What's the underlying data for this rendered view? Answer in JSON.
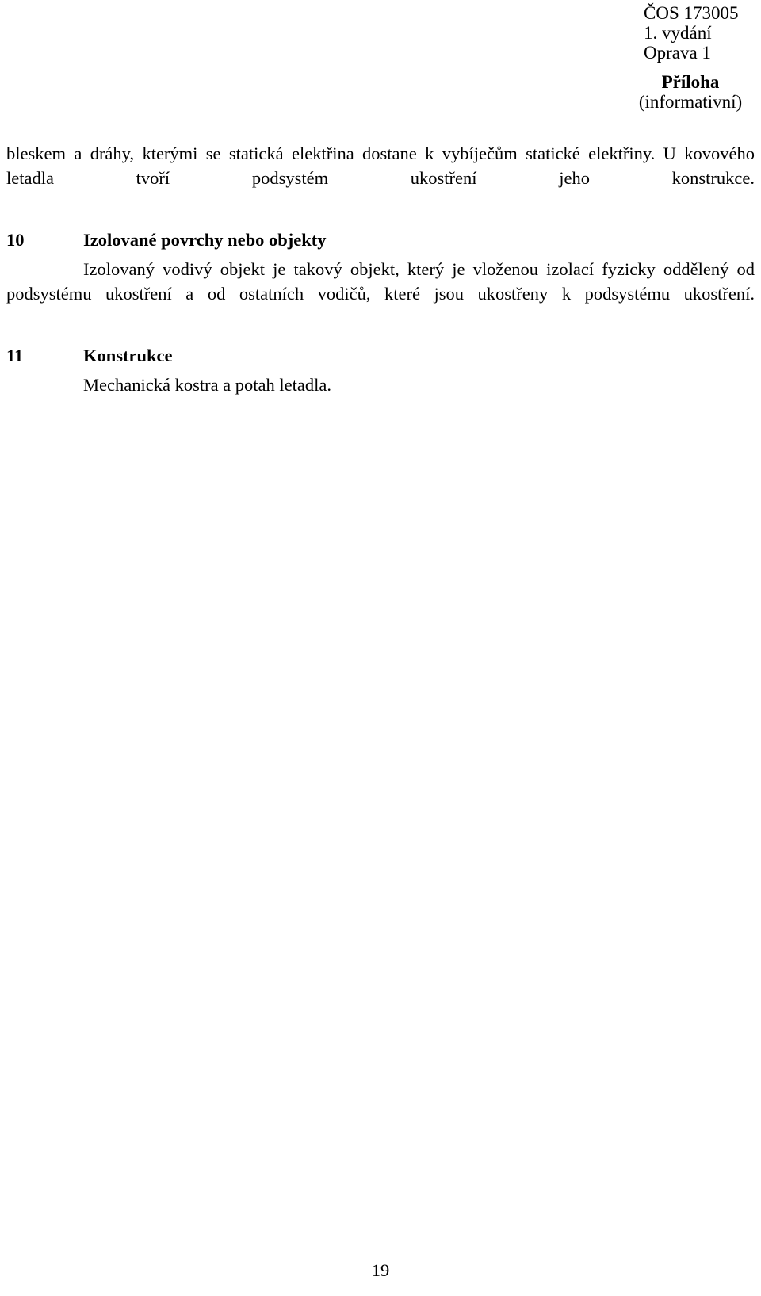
{
  "document": {
    "standard_id": "ČOS 173005",
    "edition": "1. vydání",
    "amendment": "Oprava 1",
    "annex_title": "Příloha",
    "annex_kind": "(informativní)"
  },
  "body": {
    "intro_paragraph": "bleskem a dráhy, kterými se statická elektřina dostane k vybíječům statické elektřiny. U kovového letadla tvoří podsystém ukostření jeho konstrukce.",
    "sections": [
      {
        "number": "10",
        "title": "Izolované povrchy nebo objekty",
        "text": "Izolovaný vodivý objekt je takový objekt, který je vloženou izolací fyzicky oddělený od podsystému ukostření a od ostatních vodičů, které jsou ukostřeny k podsystému ukostření."
      },
      {
        "number": "11",
        "title": "Konstrukce",
        "text": "Mechanická kostra a potah letadla."
      }
    ]
  },
  "footer": {
    "page_number": "19"
  }
}
